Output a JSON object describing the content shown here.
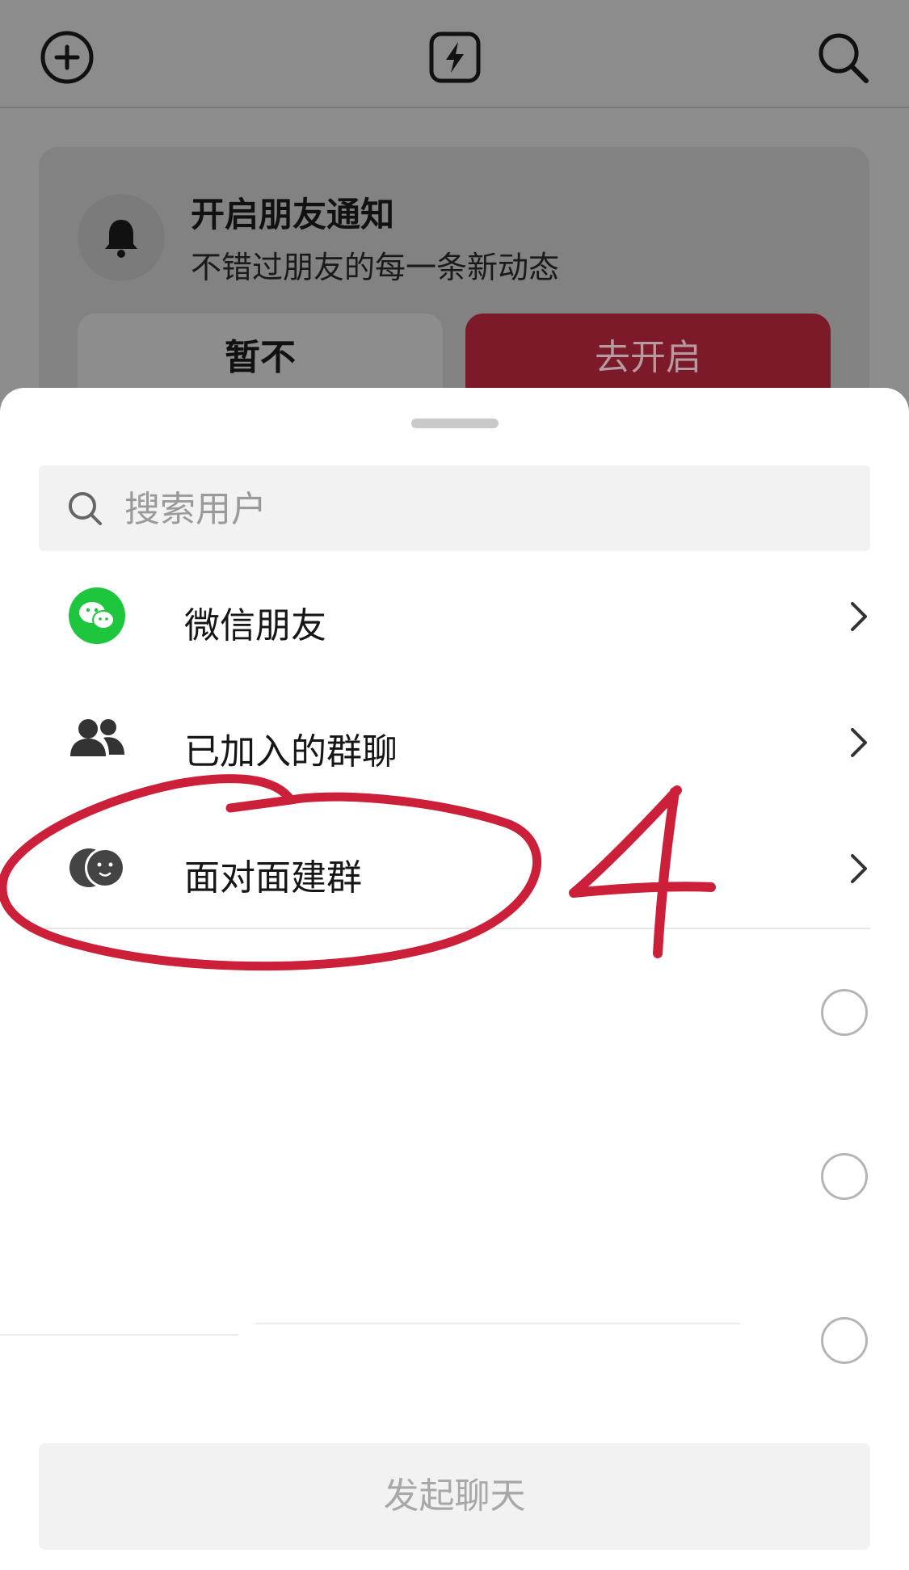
{
  "background": {
    "notification_card": {
      "title": "开启朋友通知",
      "subtitle": "不错过朋友的每一条新动态",
      "later_label": "暂不",
      "enable_label": "去开启"
    }
  },
  "sheet": {
    "search_placeholder": "搜索用户",
    "items": [
      {
        "label": "微信朋友",
        "icon": "wechat-icon"
      },
      {
        "label": "已加入的群聊",
        "icon": "group-icon"
      },
      {
        "label": "面对面建群",
        "icon": "face-to-face-icon"
      }
    ],
    "start_chat_label": "发起聊天"
  },
  "annotation": {
    "number": "4",
    "color": "#cc1f3a"
  },
  "colors": {
    "accent": "#7c1a29",
    "wechat_green": "#1dc63d"
  }
}
